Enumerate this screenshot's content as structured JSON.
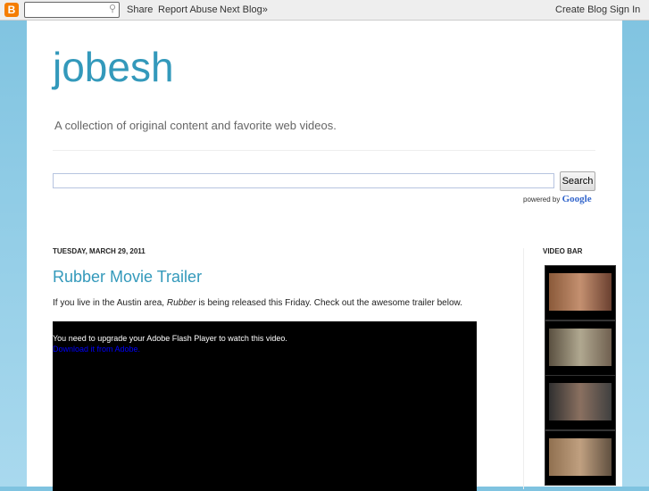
{
  "navbar": {
    "share": "Share",
    "report": "Report Abuse",
    "next": "Next Blog»",
    "create": "Create Blog",
    "signin": "Sign In",
    "logo": "B"
  },
  "header": {
    "title": "jobesh",
    "description": "A collection of original content and favorite web videos."
  },
  "search": {
    "button": "Search",
    "powered": "powered by",
    "google": "Google"
  },
  "post": {
    "date": "TUESDAY, MARCH 29, 2011",
    "title": "Rubber Movie Trailer",
    "body_pre": "If you live in the Austin area, ",
    "body_em": "Rubber",
    "body_post": " is being released this Friday. Check out the awesome trailer below.",
    "flash_msg": "You need to upgrade your Adobe Flash Player to watch this video.",
    "flash_link": "Download it from Adobe."
  },
  "sidebar": {
    "title": "VIDEO BAR"
  }
}
